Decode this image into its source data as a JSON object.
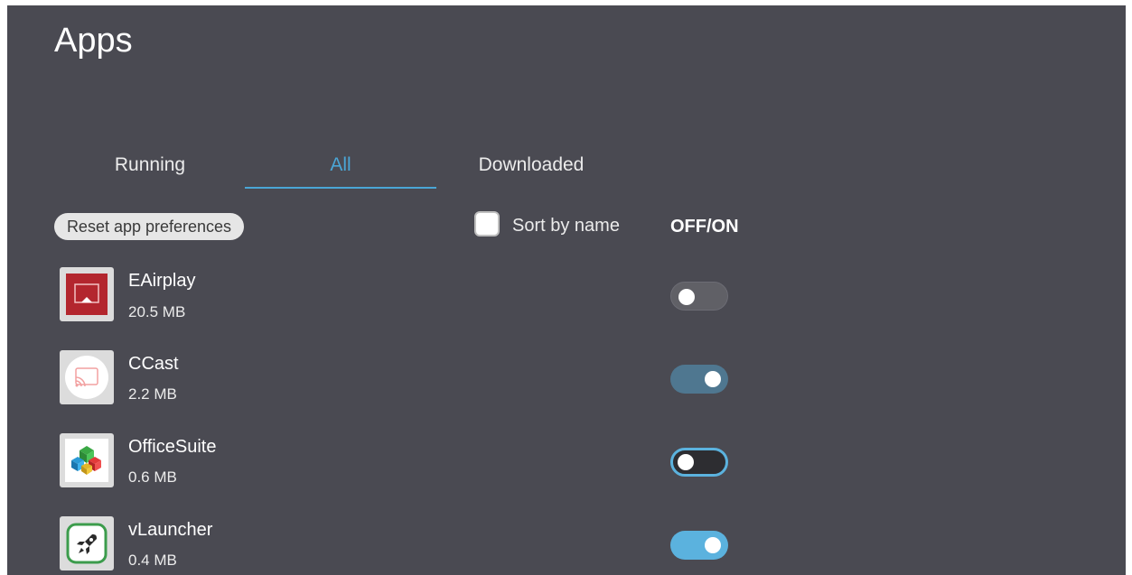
{
  "title": "Apps",
  "tabs": [
    {
      "label": "Running",
      "active": false
    },
    {
      "label": "All",
      "active": true
    },
    {
      "label": "Downloaded",
      "active": false
    }
  ],
  "toolbar": {
    "reset_label": "Reset app preferences",
    "sort_label": "Sort by name",
    "sort_checked": false,
    "offon_label": "OFF/ON"
  },
  "apps": [
    {
      "name": "EAirplay",
      "size": "20.5 MB",
      "icon": "eairplay-icon",
      "enabled": false
    },
    {
      "name": "CCast",
      "size": "2.2 MB",
      "icon": "ccast-icon",
      "enabled": true
    },
    {
      "name": "OfficeSuite",
      "size": "0.6 MB",
      "icon": "officesuite-icon",
      "enabled": false
    },
    {
      "name": "vLauncher",
      "size": "0.4 MB",
      "icon": "vlauncher-icon",
      "enabled": true
    }
  ],
  "colors": {
    "background": "#4a4a52",
    "accent": "#4aa6d6",
    "toggle_on": "#5bb2de"
  }
}
